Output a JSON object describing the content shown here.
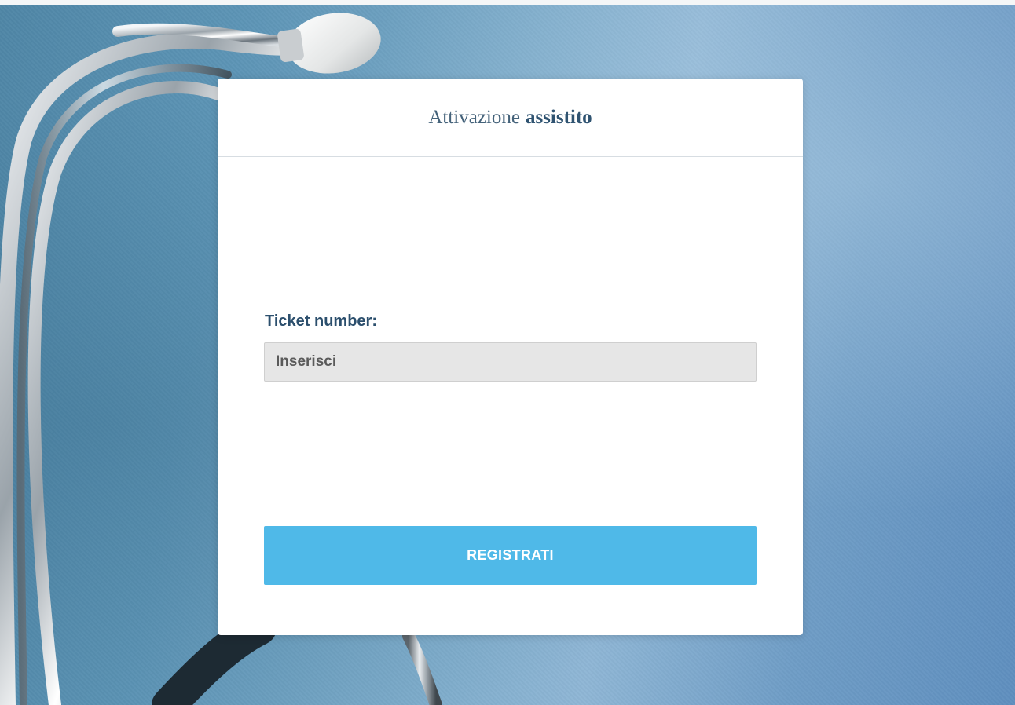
{
  "card": {
    "title_regular": "Attivazione",
    "title_bold": "assistito"
  },
  "form": {
    "ticket_label": "Ticket number:",
    "ticket_placeholder": "Inserisci",
    "ticket_value": "",
    "submit_label": "REGISTRATI"
  },
  "colors": {
    "primary_button": "#4fb9e8",
    "title_text": "#2f5371",
    "label_text": "#2c4f6d",
    "input_background": "#e6e6e6"
  },
  "background": {
    "image": "stethoscope-on-blue-fabric"
  }
}
